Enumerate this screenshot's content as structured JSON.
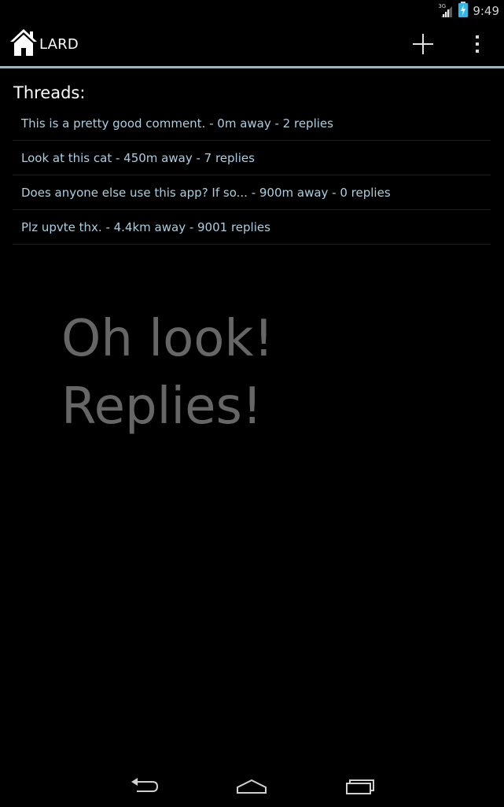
{
  "status_bar": {
    "network_type": "3G",
    "time": "9:49",
    "icons": [
      "signal-icon",
      "battery-charging-icon"
    ]
  },
  "action_bar": {
    "title": "LARD",
    "home_icon": "home-icon",
    "add_icon": "add-icon",
    "overflow_icon": "overflow-menu-icon",
    "divider_color": "#9fb6c1"
  },
  "main": {
    "heading": "Threads:",
    "threads": [
      {
        "text": "This is a pretty good comment. - 0m away - 2 replies"
      },
      {
        "text": "Look at this cat - 450m away - 7 replies"
      },
      {
        "text": "Does anyone else use this app? If so... - 900m away - 0 replies"
      },
      {
        "text": "Plz upvte thx. - 4.4km away - 9001 replies"
      }
    ],
    "overlay_lines": [
      "Oh look!",
      "Replies!"
    ]
  },
  "nav_bar": {
    "icons": [
      "back-icon",
      "home-nav-icon",
      "recent-apps-icon"
    ]
  },
  "colors": {
    "background": "#000000",
    "thread_text": "#a9cfe0",
    "overlay_text": "#666666"
  }
}
